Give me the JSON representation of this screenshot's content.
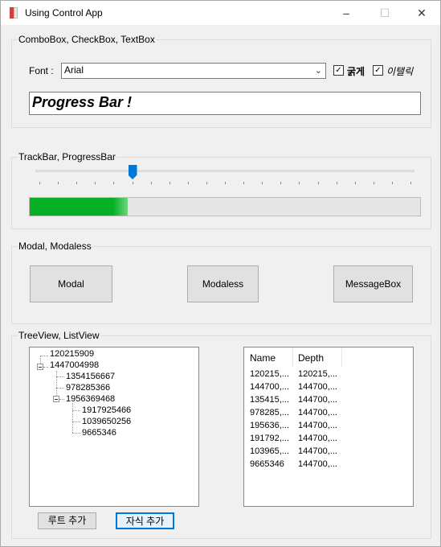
{
  "window": {
    "title": "Using Control App",
    "minimize": "–",
    "maximize": "☐",
    "close": "✕"
  },
  "group1": {
    "label": "ComboBox, CheckBox, TextBox",
    "font_label": "Font :",
    "font_value": "Arial",
    "bold_label": "굵게",
    "bold_checked": true,
    "italic_label": "이탤릭",
    "italic_checked": true,
    "text_value": "Progress Bar !"
  },
  "group2": {
    "label": "TrackBar, ProgressBar",
    "trackbar_value_fraction": 0.25,
    "progress_fraction": 0.25
  },
  "group3": {
    "label": "Modal, Modaless",
    "modal_label": "Modal",
    "modaless_label": "Modaless",
    "messagebox_label": "MessageBox"
  },
  "group4": {
    "label": "TreeView, ListView",
    "tree": {
      "n0": "120215909",
      "n1": "1447004998",
      "n1a": "1354156667",
      "n1b": "978285366",
      "n1c": "1956369468",
      "n1c1": "1917925466",
      "n1c2": "1039650256",
      "n1c3": "9665346"
    },
    "list_headers": {
      "name": "Name",
      "depth": "Depth"
    },
    "list_rows": [
      {
        "name": "120215,...",
        "depth": "120215,..."
      },
      {
        "name": "144700,...",
        "depth": "144700,..."
      },
      {
        "name": "135415,...",
        "depth": "144700,..."
      },
      {
        "name": "978285,...",
        "depth": "144700,..."
      },
      {
        "name": "195636,...",
        "depth": "144700,..."
      },
      {
        "name": "191792,...",
        "depth": "144700,..."
      },
      {
        "name": "103965,...",
        "depth": "144700,..."
      },
      {
        "name": "9665346",
        "depth": "144700,..."
      }
    ],
    "add_root_label": "루트 추가",
    "add_child_label": "자식 추가"
  }
}
